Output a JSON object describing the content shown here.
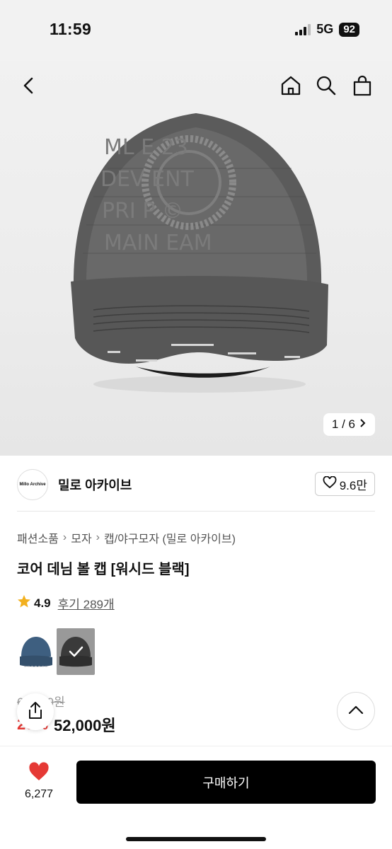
{
  "status": {
    "time": "11:59",
    "network": "5G",
    "battery": "92"
  },
  "nav": {
    "icons": [
      "back-icon",
      "home-icon",
      "search-icon",
      "bag-icon"
    ]
  },
  "image_counter": "1 / 6",
  "shop": {
    "logo_text": "Millo Archive",
    "name": "밀로 아카이브",
    "likes": "9.6만"
  },
  "breadcrumb": [
    "패션소품",
    "모자",
    "캡/야구모자 (밀로 아카이브)"
  ],
  "product": {
    "title": "코어 데님 볼 캡 [워시드 블랙]",
    "rating": "4.9",
    "reviews": "후기 289개",
    "price_original": "65,000원",
    "discount_rate": "20%",
    "price": "52,000원"
  },
  "bottom": {
    "wish_count": "6,277",
    "buy_label": "구매하기"
  },
  "colors": {
    "accent_red": "#e53935",
    "star": "#f2b01e",
    "buy_bg": "#000000"
  }
}
